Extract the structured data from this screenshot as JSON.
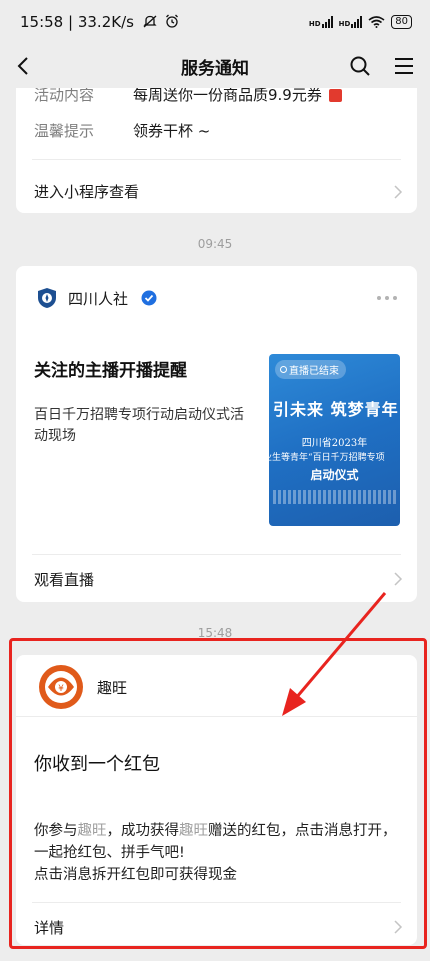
{
  "status_bar": {
    "time": "15:58",
    "network_speed": "33.2K/s",
    "signal_label": "HD",
    "battery": "80"
  },
  "nav": {
    "title": "服务通知"
  },
  "card1": {
    "rows": [
      {
        "label": "活动内容",
        "value": "每周送你一份商品质9.9元券"
      },
      {
        "label": "温馨提示",
        "value": "领券干杯 ~"
      }
    ],
    "footer_link": "进入小程序查看"
  },
  "times": [
    "09:45",
    "15:48"
  ],
  "card2": {
    "account": "四川人社",
    "title": "关注的主播开播提醒",
    "desc": "百日千万招聘专项行动启动仪式活动现场",
    "thumbnail": {
      "badge": "直播已结束",
      "slogan": "引未来 筑梦青年",
      "line1": "四川省2023年",
      "line2": "业生等青年“百日千万招聘专项",
      "line3": "启动仪式"
    },
    "footer_link": "观看直播"
  },
  "card3": {
    "account": "趣旺",
    "title": "你收到一个红包",
    "desc_parts": [
      "你参与",
      "趣旺",
      "，成功获得",
      "趣旺",
      "赠送的红包，点击消息打开，一起抢红包、拼手气吧!"
    ],
    "desc_line3": "点击消息拆开红包即可获得现金",
    "footer_link": "详情"
  },
  "colors": {
    "annotation_red": "#e8241f",
    "verified_blue": "#1f6fe0",
    "brand_orange": "#e05a1a"
  }
}
